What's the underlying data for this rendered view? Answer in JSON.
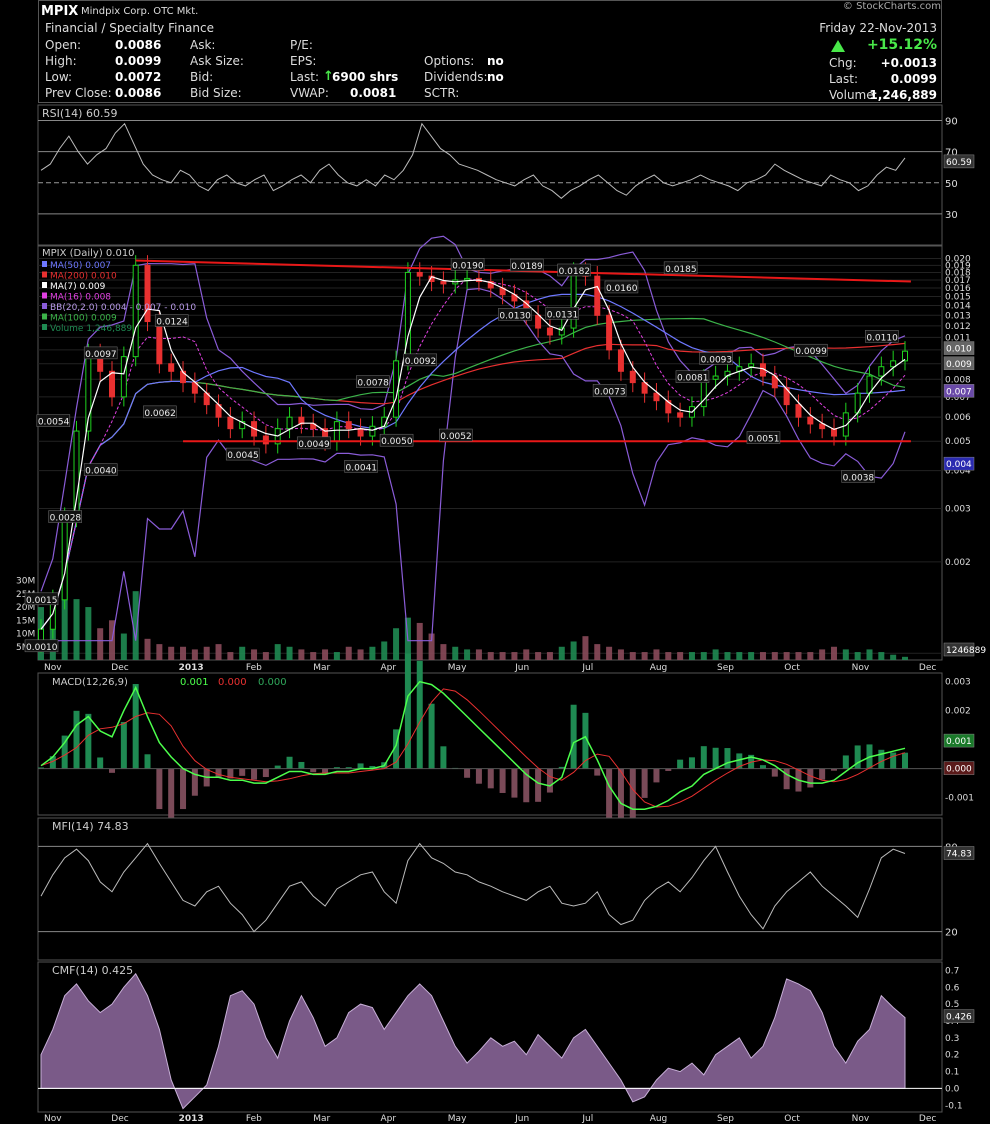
{
  "header": {
    "symbol": "MPIX",
    "company": "Mindpix Corp. OTC Mkt.",
    "sector": "Financial / Specialty Finance",
    "watermark": "© StockCharts.com",
    "date": "Friday 22-Nov-2013",
    "change_pct": "+15.12%",
    "open_label": "Open:",
    "open": "0.0086",
    "high_label": "High:",
    "high": "0.0099",
    "low_label": "Low:",
    "low": "0.0072",
    "prev_close_label": "Prev Close:",
    "prev_close": "0.0086",
    "ask_label": "Ask:",
    "ask_size_label": "Ask Size:",
    "bid_label": "Bid:",
    "bid_size_label": "Bid Size:",
    "pe_label": "P/E:",
    "eps_label": "EPS:",
    "last_label": "Last:",
    "last_trade": "6900 shrs",
    "vwap_label": "VWAP:",
    "vwap": "0.0081",
    "options_label": "Options:",
    "options": "no",
    "dividends_label": "Dividends:",
    "dividends": "no",
    "sctr_label": "SCTR:",
    "chg_label": "Chg:",
    "chg": "+0.0013",
    "last2_label": "Last:",
    "last": "0.0099",
    "volume_label": "Volume:",
    "volume": "1,246,889"
  },
  "colors": {
    "up": "#1fd21f",
    "down": "#e83030",
    "ma50": "#6e78ff",
    "ma200": "#e83030",
    "ma7": "#ffffff",
    "ma16": "#e040e0",
    "bb": "#8a5cd8",
    "ma100": "#3cb44a",
    "vol_up": "#1f8a52",
    "vol_down": "#8a4a5a",
    "trend": "#e81818",
    "rsi_fill": "#9a6aa0",
    "cmf_fill": "#7a5a88"
  },
  "chart_data": [
    {
      "type": "line",
      "title": "RSI(14) 60.59",
      "y_ticks": [
        90,
        70,
        50,
        30
      ],
      "ylim": [
        10,
        100
      ],
      "last_value_label": "60.59",
      "values": [
        58,
        62,
        72,
        80,
        70,
        62,
        68,
        72,
        82,
        88,
        75,
        62,
        55,
        52,
        50,
        58,
        55,
        48,
        45,
        52,
        55,
        50,
        48,
        52,
        55,
        45,
        48,
        52,
        55,
        50,
        58,
        62,
        55,
        50,
        48,
        52,
        48,
        55,
        52,
        58,
        68,
        88,
        80,
        72,
        68,
        62,
        60,
        58,
        55,
        52,
        50,
        48,
        52,
        55,
        48,
        45,
        40,
        45,
        48,
        52,
        55,
        50,
        45,
        42,
        48,
        52,
        55,
        50,
        48,
        50,
        52,
        55,
        52,
        50,
        48,
        45,
        50,
        52,
        55,
        62,
        58,
        55,
        52,
        50,
        48,
        55,
        52,
        50,
        45,
        48,
        55,
        60,
        58,
        66
      ]
    },
    {
      "type": "line",
      "title": "MPIX (Daily) 0.010",
      "scale": "log",
      "x_ticks": [
        "Nov",
        "Dec",
        "2013",
        "Feb",
        "Mar",
        "Apr",
        "May",
        "Jun",
        "Jul",
        "Aug",
        "Sep",
        "Oct",
        "Nov",
        "Dec"
      ],
      "y_ticks": [
        "0.020",
        "0.019",
        "0.018",
        "0.017",
        "0.016",
        "0.015",
        "0.014",
        "0.013",
        "0.012",
        "0.011",
        "0.010",
        "0.009",
        "0.008",
        "0.007",
        "0.006",
        "0.005",
        "0.004",
        "0.003",
        "0.002",
        "0.001"
      ],
      "vol_ticks": [
        "30M",
        "25M",
        "20M",
        "15M",
        "10M",
        "5M"
      ],
      "ylim": [
        0.00095,
        0.022
      ],
      "series": [
        {
          "name": "MA(50) 0.007",
          "color_key": "ma50"
        },
        {
          "name": "MA(200) 0.010",
          "color_key": "ma200"
        },
        {
          "name": "MA(7) 0.009",
          "color_key": "ma7"
        },
        {
          "name": "MA(16) 0.008",
          "color_key": "ma16"
        },
        {
          "name": "BB(20,2.0) 0.004 - 0.007 - 0.010",
          "color_key": "bb"
        },
        {
          "name": "MA(100) 0.009",
          "color_key": "ma100"
        },
        {
          "name": "Volume 1,246,889",
          "color_key": "vol_up"
        }
      ],
      "close": [
        0.0012,
        0.0015,
        0.0028,
        0.0054,
        0.0097,
        0.0085,
        0.007,
        0.0095,
        0.019,
        0.0124,
        0.009,
        0.0085,
        0.0078,
        0.0072,
        0.0066,
        0.006,
        0.0055,
        0.0058,
        0.0052,
        0.0049,
        0.0055,
        0.006,
        0.0057,
        0.0055,
        0.005,
        0.0058,
        0.0055,
        0.0052,
        0.0056,
        0.006,
        0.0092,
        0.018,
        0.0175,
        0.0168,
        0.0165,
        0.017,
        0.0172,
        0.0168,
        0.016,
        0.0152,
        0.0145,
        0.013,
        0.0118,
        0.0112,
        0.0118,
        0.018,
        0.0175,
        0.013,
        0.01,
        0.0085,
        0.0078,
        0.0072,
        0.0068,
        0.0062,
        0.006,
        0.0065,
        0.008,
        0.0082,
        0.0085,
        0.0088,
        0.009,
        0.0082,
        0.0075,
        0.0066,
        0.006,
        0.0057,
        0.0055,
        0.0052,
        0.0062,
        0.0072,
        0.0082,
        0.0088,
        0.0092,
        0.0099
      ],
      "volume_m": [
        20,
        13,
        30,
        23,
        20,
        12,
        15,
        10,
        26,
        8,
        6,
        5,
        5,
        4,
        5,
        6,
        3,
        5,
        4,
        3,
        6,
        5,
        4,
        3,
        4,
        3,
        5,
        4,
        5,
        7,
        12,
        16,
        14,
        10,
        6,
        5,
        4,
        4,
        3,
        3,
        3,
        4,
        3,
        3,
        5,
        7,
        9,
        6,
        5,
        4,
        3,
        3,
        4,
        3,
        3,
        3,
        3,
        4,
        3,
        3,
        3,
        3,
        3,
        3,
        3,
        3,
        4,
        5,
        4,
        3,
        4,
        3,
        2,
        1.2
      ],
      "labels": [
        {
          "text": "0.0015",
          "i": 0,
          "v": 0.0015
        },
        {
          "text": "0.0010",
          "i": 0,
          "v": 0.00105
        },
        {
          "text": "0.0028",
          "i": 2,
          "v": 0.0028
        },
        {
          "text": "0.0054",
          "i": 1,
          "v": 0.0058
        },
        {
          "text": "0.0097",
          "i": 5,
          "v": 0.0097
        },
        {
          "text": "0.0040",
          "i": 5,
          "v": 0.004
        },
        {
          "text": "0.0062",
          "i": 10,
          "v": 0.0062
        },
        {
          "text": "0.0124",
          "i": 11,
          "v": 0.0124
        },
        {
          "text": "0.0045",
          "i": 17,
          "v": 0.0045
        },
        {
          "text": "0.0049",
          "i": 23,
          "v": 0.0049
        },
        {
          "text": "0.0078",
          "i": 28,
          "v": 0.0078
        },
        {
          "text": "0.0041",
          "i": 27,
          "v": 0.0041
        },
        {
          "text": "0.0050",
          "i": 30,
          "v": 0.005
        },
        {
          "text": "0.0052",
          "i": 35,
          "v": 0.0052
        },
        {
          "text": "0.0092",
          "i": 32,
          "v": 0.0092
        },
        {
          "text": "0.0190",
          "i": 36,
          "v": 0.019
        },
        {
          "text": "0.0189",
          "i": 41,
          "v": 0.0189
        },
        {
          "text": "0.0182",
          "i": 45,
          "v": 0.0182
        },
        {
          "text": "0.0130",
          "i": 40,
          "v": 0.013
        },
        {
          "text": "0.0131",
          "i": 44,
          "v": 0.0131
        },
        {
          "text": "0.0160",
          "i": 49,
          "v": 0.016
        },
        {
          "text": "0.0073",
          "i": 48,
          "v": 0.0073
        },
        {
          "text": "0.0185",
          "i": 54,
          "v": 0.0185
        },
        {
          "text": "0.0093",
          "i": 57,
          "v": 0.0093
        },
        {
          "text": "0.0081",
          "i": 55,
          "v": 0.0081
        },
        {
          "text": "0.0051",
          "i": 61,
          "v": 0.0051
        },
        {
          "text": "0.0099",
          "i": 65,
          "v": 0.0099
        },
        {
          "text": "0.0110",
          "i": 71,
          "v": 0.011
        },
        {
          "text": "0.0038",
          "i": 69,
          "v": 0.0038
        }
      ],
      "trendlines": [
        {
          "i0": 8,
          "v0": 0.0197,
          "i1": 73.5,
          "v1": 0.0168
        },
        {
          "i0": 12,
          "v0": 0.005,
          "i1": 73.5,
          "v1": 0.005
        }
      ],
      "price_markers": [
        "0.010",
        "0.009",
        "0.007",
        "0.004"
      ],
      "volume_marker": "1246889"
    },
    {
      "type": "line",
      "title": "MACD(12,26,9)",
      "title_values": [
        "0.001",
        "0.000",
        "0.000"
      ],
      "y_ticks": [
        "0.003",
        "0.002",
        "0.001",
        "0.000",
        "-0.001"
      ],
      "ylim": [
        -0.0016,
        0.0033
      ],
      "last_value_labels": [
        "0.001",
        "0.000"
      ],
      "values": [
        0.0001,
        0.0004,
        0.0009,
        0.0015,
        0.0018,
        0.0013,
        0.0011,
        0.002,
        0.0028,
        0.0018,
        0.0009,
        0.0004,
        0.0,
        -0.0002,
        -0.0003,
        -0.0003,
        -0.0004,
        -0.0004,
        -0.0005,
        -0.0005,
        -0.0003,
        -0.0001,
        -0.0001,
        -0.0002,
        -0.0002,
        -0.0001,
        -0.0001,
        0.0,
        0.0,
        0.0001,
        0.0008,
        0.0025,
        0.003,
        0.0029,
        0.0026,
        0.0022,
        0.0018,
        0.0014,
        0.001,
        0.0006,
        0.0002,
        -0.0002,
        -0.0005,
        -0.0006,
        -0.0003,
        0.0009,
        0.0011,
        0.0003,
        -0.0006,
        -0.0012,
        -0.0014,
        -0.0014,
        -0.0013,
        -0.0011,
        -0.0008,
        -0.0006,
        -0.0002,
        0.0,
        0.0002,
        0.0003,
        0.0004,
        0.0003,
        0.0001,
        -0.0002,
        -0.0004,
        -0.0005,
        -0.0005,
        -0.0004,
        -0.0001,
        0.0002,
        0.0004,
        0.0005,
        0.0006,
        0.0007
      ]
    },
    {
      "type": "line",
      "title": "MFI(14) 74.83",
      "y_ticks": [
        80,
        20
      ],
      "ylim": [
        0,
        100
      ],
      "last_value_label": "74.83",
      "values": [
        45,
        60,
        72,
        78,
        70,
        55,
        48,
        62,
        72,
        82,
        68,
        55,
        42,
        38,
        48,
        52,
        40,
        32,
        20,
        28,
        40,
        52,
        55,
        45,
        38,
        50,
        55,
        60,
        62,
        48,
        40,
        70,
        82,
        72,
        68,
        62,
        60,
        55,
        52,
        48,
        45,
        42,
        48,
        52,
        40,
        38,
        40,
        48,
        32,
        25,
        28,
        42,
        50,
        55,
        48,
        58,
        70,
        80,
        62,
        45,
        32,
        22,
        38,
        48,
        55,
        62,
        52,
        45,
        38,
        30,
        50,
        72,
        78,
        75
      ]
    },
    {
      "type": "area",
      "title": "CMF(14) 0.425",
      "y_ticks": [
        "0.7",
        "0.6",
        "0.5",
        "0.4",
        "0.3",
        "0.2",
        "0.1",
        "0.0",
        "-0.1"
      ],
      "ylim": [
        -0.14,
        0.75
      ],
      "last_value_label": "0.426",
      "values": [
        0.2,
        0.35,
        0.55,
        0.62,
        0.52,
        0.45,
        0.5,
        0.6,
        0.68,
        0.55,
        0.35,
        0.05,
        -0.12,
        -0.05,
        0.02,
        0.25,
        0.55,
        0.58,
        0.5,
        0.3,
        0.18,
        0.4,
        0.55,
        0.42,
        0.25,
        0.3,
        0.45,
        0.5,
        0.48,
        0.35,
        0.45,
        0.55,
        0.62,
        0.55,
        0.4,
        0.25,
        0.15,
        0.22,
        0.3,
        0.25,
        0.28,
        0.2,
        0.32,
        0.25,
        0.18,
        0.3,
        0.35,
        0.25,
        0.15,
        0.05,
        -0.08,
        -0.05,
        0.05,
        0.12,
        0.1,
        0.15,
        0.08,
        0.2,
        0.25,
        0.3,
        0.18,
        0.25,
        0.42,
        0.65,
        0.62,
        0.58,
        0.45,
        0.25,
        0.15,
        0.28,
        0.35,
        0.55,
        0.48,
        0.42
      ]
    }
  ]
}
